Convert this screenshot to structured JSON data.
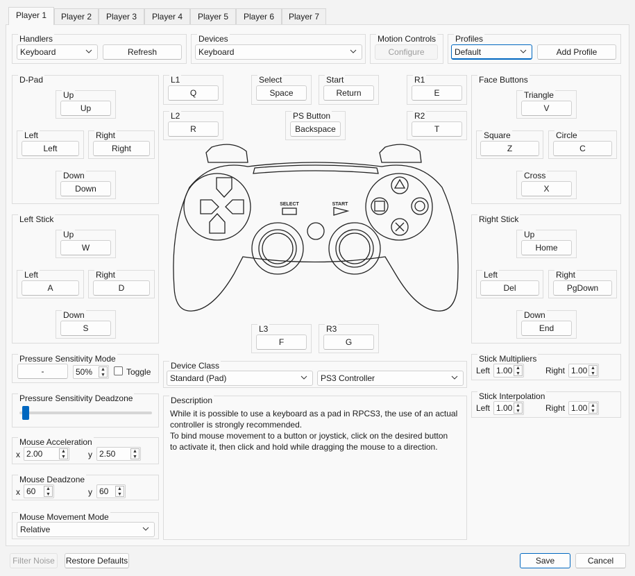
{
  "tabs": [
    "Player 1",
    "Player 2",
    "Player 3",
    "Player 4",
    "Player 5",
    "Player 6",
    "Player 7"
  ],
  "handlers": {
    "title": "Handlers",
    "selected": "Keyboard",
    "refresh": "Refresh"
  },
  "devices": {
    "title": "Devices",
    "selected": "Keyboard"
  },
  "motion": {
    "title": "Motion Controls",
    "configure": "Configure"
  },
  "profiles": {
    "title": "Profiles",
    "selected": "Default",
    "add": "Add Profile"
  },
  "dpad": {
    "title": "D-Pad",
    "up_label": "Up",
    "up": "Up",
    "left_label": "Left",
    "left": "Left",
    "right_label": "Right",
    "right": "Right",
    "down_label": "Down",
    "down": "Down"
  },
  "left_stick": {
    "title": "Left Stick",
    "up_label": "Up",
    "up": "W",
    "left_label": "Left",
    "left": "A",
    "right_label": "Right",
    "right": "D",
    "down_label": "Down",
    "down": "S"
  },
  "l1": {
    "title": "L1",
    "key": "Q"
  },
  "l2": {
    "title": "L2",
    "key": "R"
  },
  "select": {
    "title": "Select",
    "key": "Space"
  },
  "start": {
    "title": "Start",
    "key": "Return"
  },
  "ps": {
    "title": "PS Button",
    "key": "Backspace"
  },
  "r1": {
    "title": "R1",
    "key": "E"
  },
  "r2": {
    "title": "R2",
    "key": "T"
  },
  "l3": {
    "title": "L3",
    "key": "F"
  },
  "r3": {
    "title": "R3",
    "key": "G"
  },
  "controller": {
    "select_text": "SELECT",
    "start_text": "START"
  },
  "face": {
    "title": "Face Buttons",
    "triangle_label": "Triangle",
    "triangle": "V",
    "square_label": "Square",
    "square": "Z",
    "circle_label": "Circle",
    "circle": "C",
    "cross_label": "Cross",
    "cross": "X"
  },
  "right_stick": {
    "title": "Right Stick",
    "up_label": "Up",
    "up": "Home",
    "left_label": "Left",
    "left": "Del",
    "right_label": "Right",
    "right": "PgDown",
    "down_label": "Down",
    "down": "End"
  },
  "pressure_mode": {
    "title": "Pressure Sensitivity Mode",
    "button": "-",
    "value": "50%",
    "toggle": "Toggle"
  },
  "pressure_deadzone": {
    "title": "Pressure Sensitivity Deadzone",
    "value": 0.02
  },
  "mouse_accel": {
    "title": "Mouse Acceleration",
    "x_label": "x",
    "x": "2.00",
    "y_label": "y",
    "y": "2.50"
  },
  "mouse_deadzone": {
    "title": "Mouse Deadzone",
    "x_label": "x",
    "x": "60",
    "y_label": "y",
    "y": "60"
  },
  "mouse_mode": {
    "title": "Mouse Movement Mode",
    "selected": "Relative"
  },
  "device_class": {
    "title": "Device Class",
    "class": "Standard (Pad)",
    "type": "PS3 Controller"
  },
  "description": {
    "title": "Description",
    "lines": [
      "While it is possible to use a keyboard as a pad in RPCS3, the use of an actual",
      "controller is strongly recommended.",
      "To bind mouse movement to a button or joystick, click on the desired button",
      "to activate it, then click and hold while dragging the mouse to a direction."
    ]
  },
  "stick_mult": {
    "title": "Stick Multipliers",
    "left_label": "Left",
    "left": "1.00",
    "right_label": "Right",
    "right": "1.00"
  },
  "stick_interp": {
    "title": "Stick Interpolation",
    "left_label": "Left",
    "left": "1.00",
    "right_label": "Right",
    "right": "1.00"
  },
  "footer": {
    "filter_noise": "Filter Noise",
    "restore": "Restore Defaults",
    "save": "Save",
    "cancel": "Cancel"
  },
  "colors": {
    "accent": "#0067c0",
    "background": "#f3f3f3",
    "panel": "#f9f9f9"
  }
}
